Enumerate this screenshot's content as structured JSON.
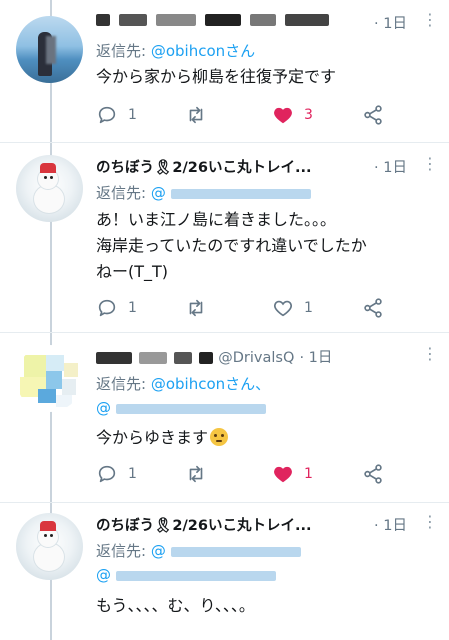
{
  "tweets": [
    {
      "display_name": "",
      "screen_name": "",
      "time": "· 1日",
      "replying_prefix": "返信先: ",
      "replying_to": [
        "@obihconさん"
      ],
      "text_lines": [
        "今から家から柳島を往復予定です"
      ],
      "reply_count": "1",
      "retweet_count": "",
      "like_count": "3",
      "liked": true
    },
    {
      "display_name": "のちぼう🎗2/26いこ丸トレイ...",
      "screen_name": "",
      "time": "· 1日",
      "replying_prefix": "返信先: ",
      "replying_to": [
        "@"
      ],
      "text_lines": [
        "あ！いま江ノ島に着きました。。。",
        "海岸走っていたのですれ違いでしたか",
        "ねー(T_T)"
      ],
      "reply_count": "1",
      "retweet_count": "",
      "like_count": "1",
      "liked": false
    },
    {
      "display_name": "",
      "screen_name": "@DrivalsQ",
      "time": "· 1日",
      "replying_prefix": "返信先: ",
      "replying_to": [
        "@obihconさん、",
        "@"
      ],
      "text_lines": [
        "今からゆきます"
      ],
      "reply_count": "1",
      "retweet_count": "",
      "like_count": "1",
      "liked": true
    },
    {
      "display_name": "のちぼう🎗2/26いこ丸トレイ...",
      "screen_name": "",
      "time": "· 1日",
      "replying_prefix": "返信先: ",
      "replying_to": [
        "@",
        "@"
      ],
      "text_lines": [
        "もう、、、、む、り、、、。"
      ],
      "reply_count": "",
      "retweet_count": "",
      "like_count": "",
      "liked": false
    }
  ],
  "icons": {
    "reply": "speech-bubble-icon",
    "retweet": "retweet-arrows-icon",
    "like": "heart-icon",
    "share": "share-nodes-icon",
    "more": "vertical-ellipsis-icon",
    "emoji": "face-with-rolling-eyes-emoji"
  },
  "colors": {
    "link": "#1da1f2",
    "muted": "#657786",
    "like_active": "#e0245e",
    "thread_line": "#c9d3dc"
  }
}
